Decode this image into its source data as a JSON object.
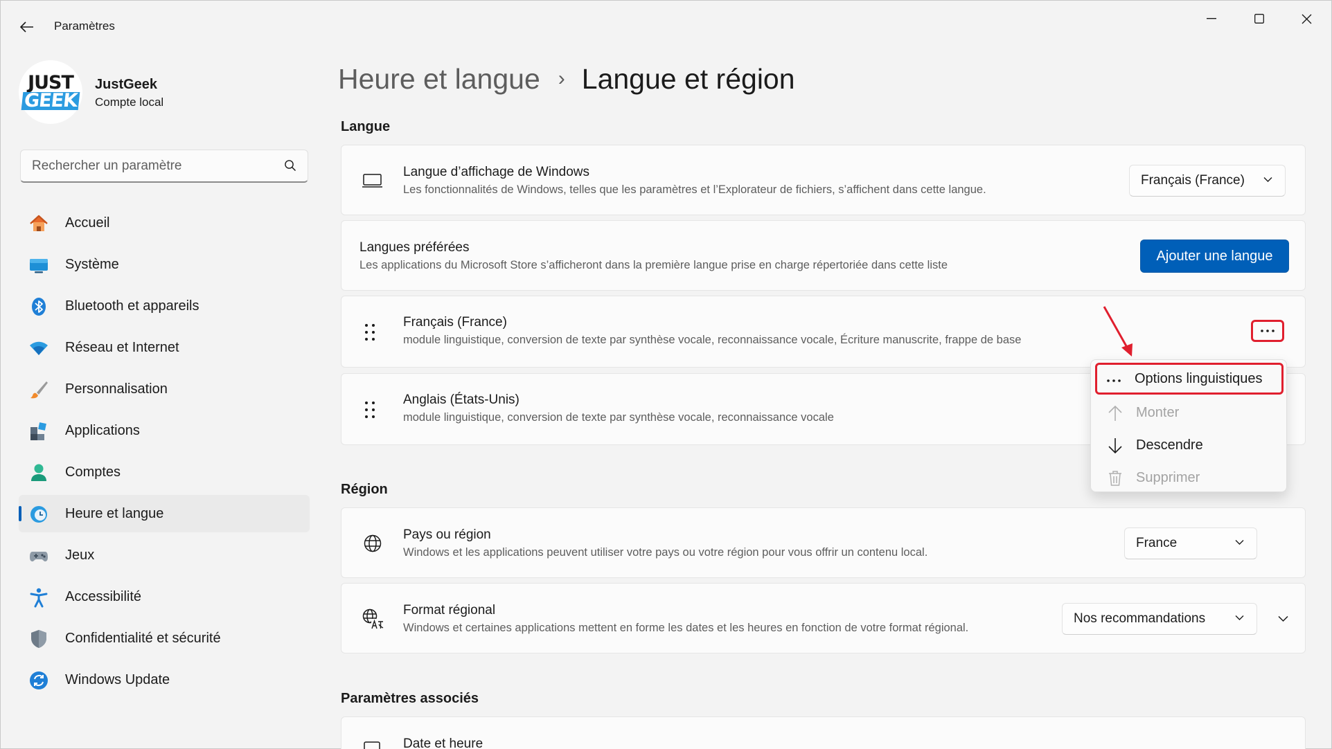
{
  "window": {
    "title": "Paramètres"
  },
  "profile": {
    "name": "JustGeek",
    "account_type": "Compte local",
    "avatar_line1": "JUST",
    "avatar_line2": "GEEK"
  },
  "search": {
    "placeholder": "Rechercher un paramètre"
  },
  "sidebar": {
    "items": [
      {
        "label": "Accueil",
        "icon": "home-icon"
      },
      {
        "label": "Système",
        "icon": "system-icon"
      },
      {
        "label": "Bluetooth et appareils",
        "icon": "bluetooth-icon"
      },
      {
        "label": "Réseau et Internet",
        "icon": "wifi-icon"
      },
      {
        "label": "Personnalisation",
        "icon": "brush-icon"
      },
      {
        "label": "Applications",
        "icon": "apps-icon"
      },
      {
        "label": "Comptes",
        "icon": "person-icon"
      },
      {
        "label": "Heure et langue",
        "icon": "clock-globe-icon",
        "active": true
      },
      {
        "label": "Jeux",
        "icon": "gamepad-icon"
      },
      {
        "label": "Accessibilité",
        "icon": "accessibility-icon"
      },
      {
        "label": "Confidentialité et sécurité",
        "icon": "shield-icon"
      },
      {
        "label": "Windows Update",
        "icon": "update-icon"
      }
    ]
  },
  "breadcrumb": {
    "parent": "Heure et langue",
    "separator": "›",
    "current": "Langue et région"
  },
  "langue": {
    "section_title": "Langue",
    "display_language": {
      "title": "Langue d’affichage de Windows",
      "description": "Les fonctionnalités de Windows, telles que les paramètres et l’Explorateur de fichiers, s’affichent dans cette langue.",
      "value": "Français (France)"
    },
    "preferred": {
      "title": "Langues préférées",
      "description": "Les applications du Microsoft Store s’afficheront dans la première langue prise en charge répertoriée dans cette liste",
      "button": "Ajouter une langue"
    },
    "languages": [
      {
        "name": "Français (France)",
        "features": "module linguistique, conversion de texte par synthèse vocale, reconnaissance vocale, Écriture manuscrite, frappe de base"
      },
      {
        "name": "Anglais (États-Unis)",
        "features": "module linguistique, conversion de texte par synthèse vocale, reconnaissance vocale"
      }
    ]
  },
  "context_menu": {
    "items": [
      {
        "label": "Options linguistiques",
        "icon": "more-icon",
        "disabled": false
      },
      {
        "label": "Monter",
        "icon": "arrow-up-icon",
        "disabled": true
      },
      {
        "label": "Descendre",
        "icon": "arrow-down-icon",
        "disabled": false
      },
      {
        "label": "Supprimer",
        "icon": "trash-icon",
        "disabled": true
      }
    ]
  },
  "region": {
    "section_title": "Région",
    "country": {
      "title": "Pays ou région",
      "description": "Windows et les applications peuvent utiliser votre pays ou votre région pour vous offrir un contenu local.",
      "value": "France"
    },
    "format": {
      "title": "Format régional",
      "description": "Windows et certaines applications mettent en forme les dates et les heures en fonction de votre format régional.",
      "value": "Nos recommandations"
    }
  },
  "related": {
    "section_title": "Paramètres associés",
    "items": [
      {
        "title": "Date et heure"
      }
    ]
  },
  "colors": {
    "accent": "#005fb8",
    "annotation": "#e01f2e"
  }
}
